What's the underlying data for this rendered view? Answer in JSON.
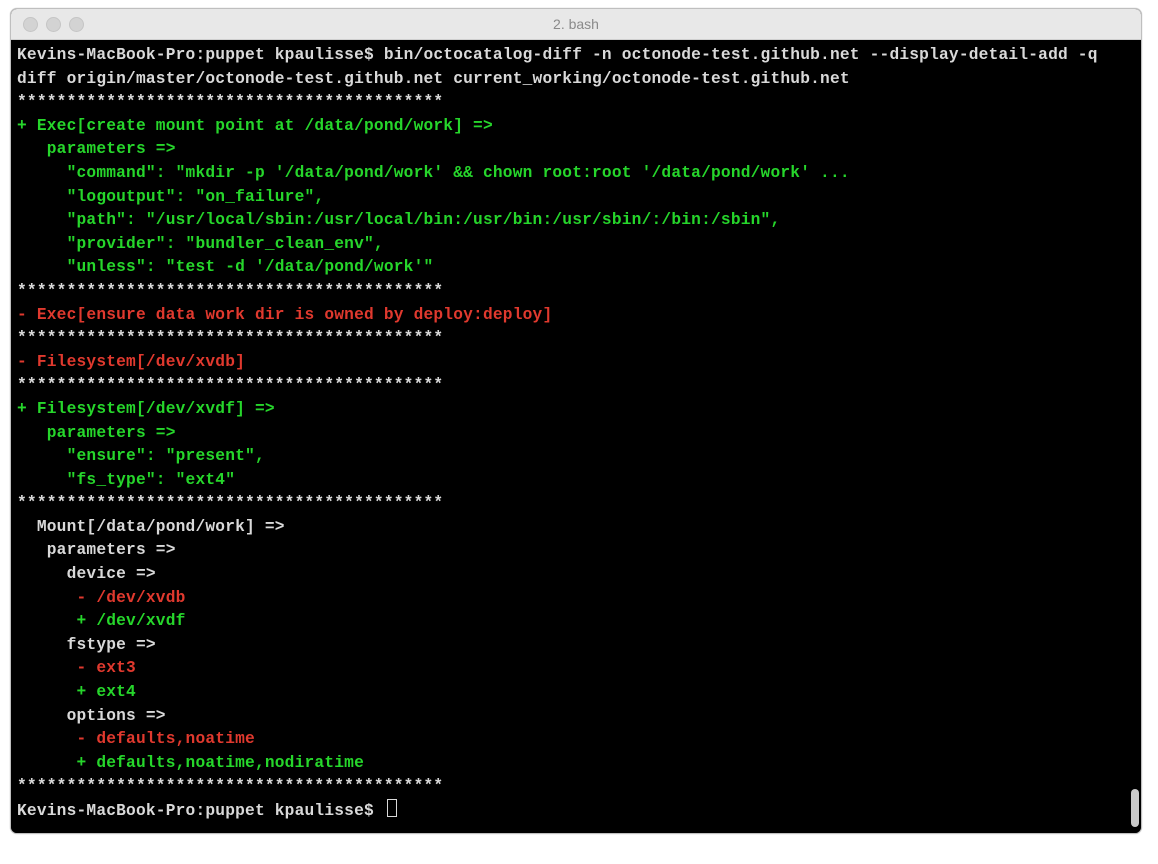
{
  "window": {
    "title": "2. bash"
  },
  "lines": [
    {
      "cls": "w",
      "text": "Kevins-MacBook-Pro:puppet kpaulisse$ bin/octocatalog-diff -n octonode-test.github.net --display-detail-add -q"
    },
    {
      "cls": "w",
      "text": "diff origin/master/octonode-test.github.net current_working/octonode-test.github.net"
    },
    {
      "cls": "w",
      "text": "*******************************************"
    },
    {
      "cls": "g",
      "text": "+ Exec[create mount point at /data/pond/work] =>"
    },
    {
      "cls": "g",
      "text": "   parameters =>"
    },
    {
      "cls": "g",
      "text": "     \"command\": \"mkdir -p '/data/pond/work' && chown root:root '/data/pond/work' ..."
    },
    {
      "cls": "g",
      "text": "     \"logoutput\": \"on_failure\","
    },
    {
      "cls": "g",
      "text": "     \"path\": \"/usr/local/sbin:/usr/local/bin:/usr/bin:/usr/sbin/:/bin:/sbin\","
    },
    {
      "cls": "g",
      "text": "     \"provider\": \"bundler_clean_env\","
    },
    {
      "cls": "g",
      "text": "     \"unless\": \"test -d '/data/pond/work'\""
    },
    {
      "cls": "w",
      "text": "*******************************************"
    },
    {
      "cls": "r",
      "text": "- Exec[ensure data work dir is owned by deploy:deploy]"
    },
    {
      "cls": "w",
      "text": "*******************************************"
    },
    {
      "cls": "r",
      "text": "- Filesystem[/dev/xvdb]"
    },
    {
      "cls": "w",
      "text": "*******************************************"
    },
    {
      "cls": "g",
      "text": "+ Filesystem[/dev/xvdf] =>"
    },
    {
      "cls": "g",
      "text": "   parameters =>"
    },
    {
      "cls": "g",
      "text": "     \"ensure\": \"present\","
    },
    {
      "cls": "g",
      "text": "     \"fs_type\": \"ext4\""
    },
    {
      "cls": "w",
      "text": "*******************************************"
    },
    {
      "cls": "w",
      "text": "  Mount[/data/pond/work] =>"
    },
    {
      "cls": "w",
      "text": "   parameters =>"
    },
    {
      "cls": "w",
      "text": "     device =>"
    },
    {
      "cls": "r",
      "text": "      - /dev/xvdb"
    },
    {
      "cls": "g",
      "text": "      + /dev/xvdf"
    },
    {
      "cls": "w",
      "text": "     fstype =>"
    },
    {
      "cls": "r",
      "text": "      - ext3"
    },
    {
      "cls": "g",
      "text": "      + ext4"
    },
    {
      "cls": "w",
      "text": "     options =>"
    },
    {
      "cls": "r",
      "text": "      - defaults,noatime"
    },
    {
      "cls": "g",
      "text": "      + defaults,noatime,nodiratime"
    },
    {
      "cls": "w",
      "text": "*******************************************"
    }
  ],
  "prompt2": "Kevins-MacBook-Pro:puppet kpaulisse$"
}
